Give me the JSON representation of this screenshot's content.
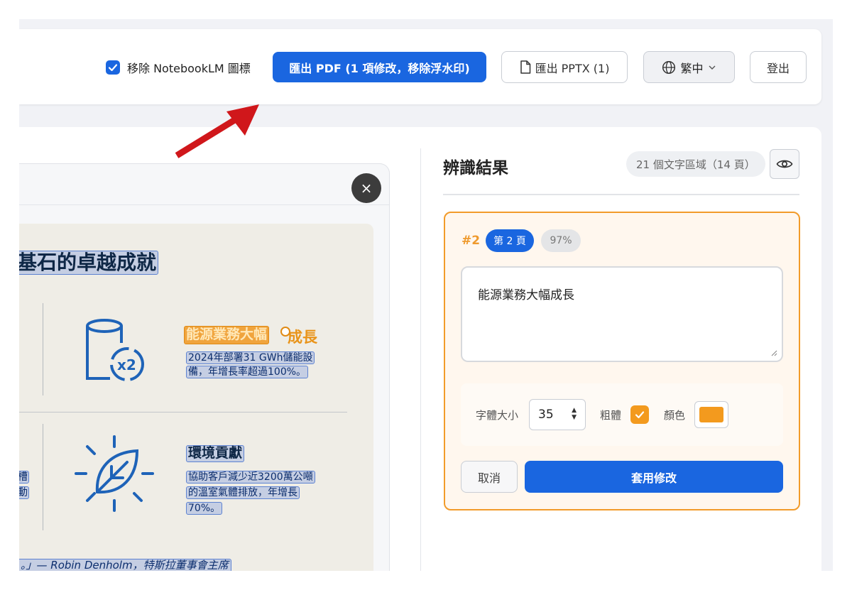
{
  "header": {
    "remove_logo_label": "移除 NotebookLM 圖標",
    "remove_logo_checked": true,
    "export_pdf_label": "匯出 PDF (1 項修改，移除浮水印)",
    "export_pptx_label": "匯出 PPTX (1)",
    "language_label": "繁中",
    "logout_label": "登出"
  },
  "preview": {
    "close_icon": "×",
    "slide": {
      "title": "基石的卓越成就",
      "items": [
        {
          "heading_selected": "能源業務大幅",
          "heading_rest": "成長",
          "desc_lines": [
            "2024年部署31 GWh儲能設",
            "備，年增長率超過100%。"
          ]
        },
        {
          "heading": "環境貢獻",
          "desc_lines": [
            "協助客戶減少近3200萬公噸",
            "的溫室氣體排放，年增長",
            "70%。"
          ]
        }
      ],
      "left_fragments": [
        "槽",
        "動"
      ],
      "quote": "。」— Robin Denholm，特斯拉董事會主席"
    }
  },
  "results": {
    "title": "辨識結果",
    "count_badge": "21 個文字區域（14 頁）",
    "card": {
      "number": "#2",
      "page_badge": "第 2 頁",
      "confidence": "97%",
      "text_value": "能源業務大幅成長",
      "font_size_label": "字體大小",
      "font_size_value": "35",
      "bold_label": "粗體",
      "bold_checked": true,
      "color_label": "顏色",
      "color_value": "#f39a1e",
      "cancel_label": "取消",
      "apply_label": "套用修改"
    }
  },
  "colors": {
    "primary": "#1a66e0",
    "accent": "#f29b2a",
    "annotation_arrow": "#d0171b"
  }
}
